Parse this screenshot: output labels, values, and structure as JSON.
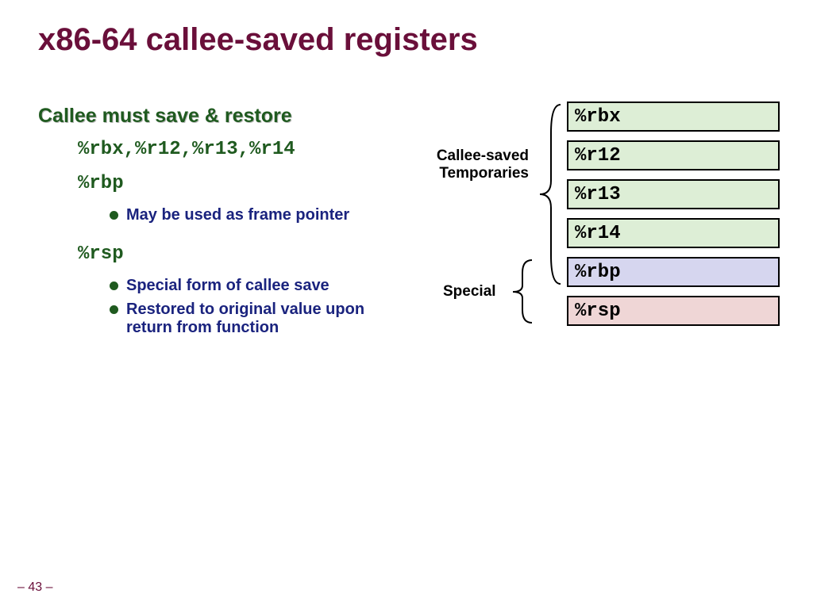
{
  "title": "x86-64 callee-saved registers",
  "subtitle": "Callee must save & restore",
  "reglist": "%rbx,%r12,%r13,%r14",
  "rbp": "%rbp",
  "rsp": "%rsp",
  "bullets": {
    "rbp1": "May be used as frame pointer",
    "rsp1": "Special form of callee save",
    "rsp2": "Restored to original value upon return from function"
  },
  "labels": {
    "callee_saved": "Callee-saved",
    "temporaries": "Temporaries",
    "special": "Special"
  },
  "registers": {
    "rbx": "%rbx",
    "r12": "%r12",
    "r13": "%r13",
    "r14": "%r14",
    "rbp": "%rbp",
    "rsp": "%rsp"
  },
  "footer": "– 43 –"
}
